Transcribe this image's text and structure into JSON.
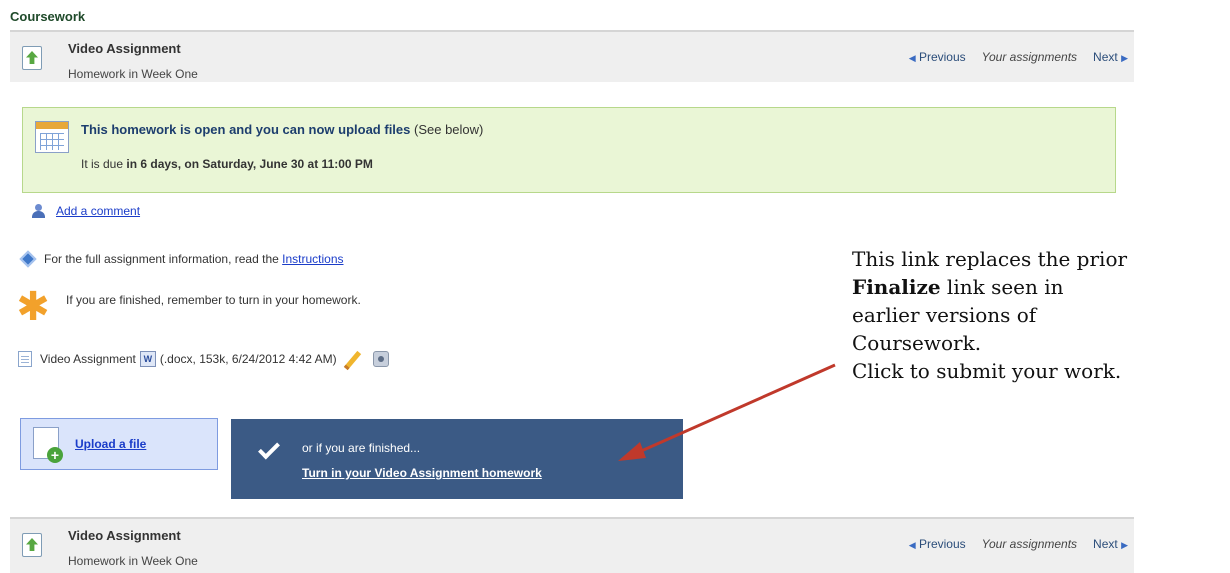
{
  "section_title": "Coursework",
  "assignment_header": {
    "title": "Video Assignment",
    "subtitle": "Homework in Week One",
    "nav": {
      "previous": "Previous",
      "your_assignments": "Your assignments",
      "next": "Next"
    }
  },
  "notice": {
    "headline": "This homework is open and you can now upload files",
    "headline_suffix": "(See below)",
    "due_prefix": "It is due",
    "due_value": "in 6 days, on Saturday, June 30 at 11:00 PM"
  },
  "add_comment": "Add a comment",
  "instructions": {
    "prefix": "For the full assignment information, read the",
    "link": "Instructions"
  },
  "finished_reminder": "If you are finished, remember to turn in your homework.",
  "file": {
    "name": "Video Assignment",
    "meta": "(.docx, 153k, 6/24/2012 4:42 AM)"
  },
  "upload": {
    "label": "Upload a file"
  },
  "turn_in": {
    "pre": "or if you are finished...",
    "link": "Turn in your Video Assignment homework"
  },
  "callout": {
    "line1": "This link replaces the prior",
    "line2_bold": "Finalize",
    "line2_rest": " link seen in",
    "line3": "earlier versions of",
    "line4": "Coursework.",
    "line5": "Click to submit your work."
  },
  "colors": {
    "notice_bg": "#eaf6d6",
    "turn_in_bg": "#3b5a85",
    "link": "#1a3cc9",
    "arrow": "#c0392b"
  }
}
